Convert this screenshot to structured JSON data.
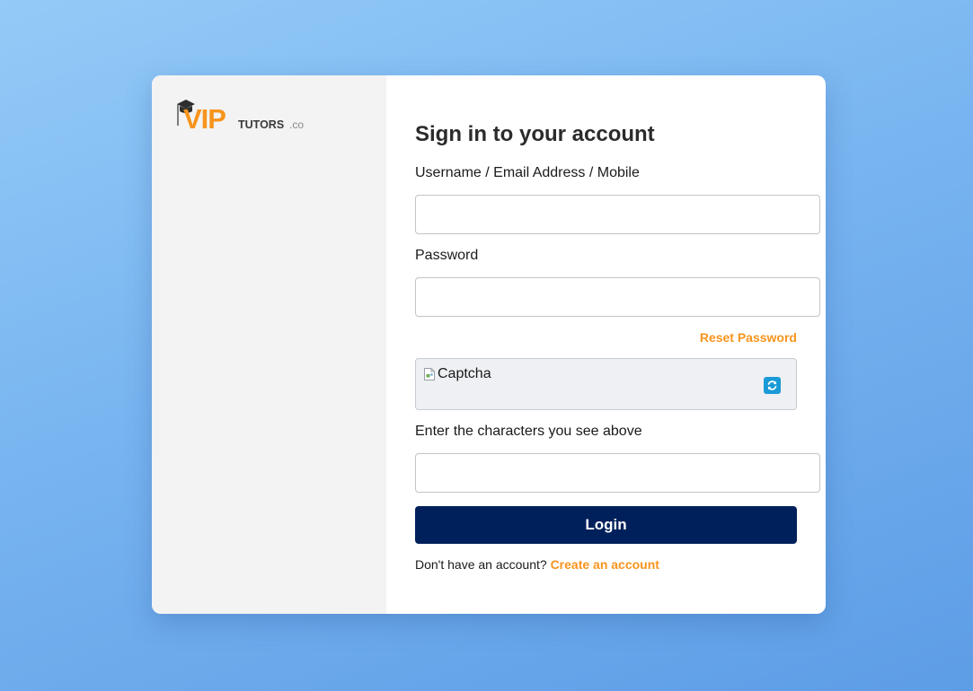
{
  "brand": {
    "logo_main": "VIP",
    "logo_sub": "TUTORS",
    "logo_suffix": ".co",
    "colors": {
      "orange": "#f7941d",
      "dark_gray": "#3a3a3a",
      "light_gray": "#8a8a8a"
    }
  },
  "form": {
    "title": "Sign in to your account",
    "username_label": "Username / Email Address / Mobile",
    "username_value": "",
    "password_label": "Password",
    "password_value": "",
    "reset_password_link": "Reset Password",
    "captcha_alt": "Captcha",
    "captcha_refresh_icon": "refresh-icon",
    "captcha_label": "Enter the characters you see above",
    "captcha_value": "",
    "login_button": "Login",
    "signup_prompt": "Don't have an account?",
    "signup_link": "Create an account"
  },
  "theme": {
    "accent": "#f7941d",
    "primary_button": "#00205b",
    "refresh_button": "#1a9ad6"
  }
}
